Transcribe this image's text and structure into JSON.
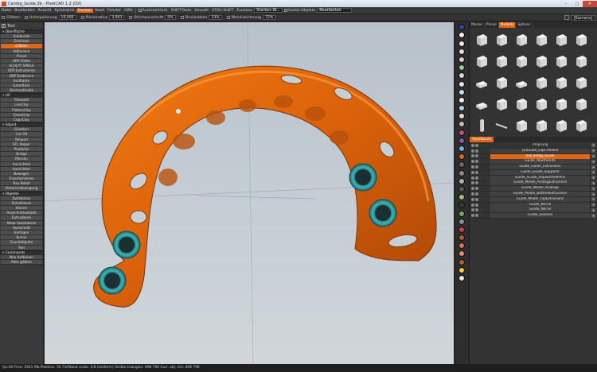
{
  "window": {
    "title": "Cambg_Guide.3b - PixelCAD 1.2 (DX)",
    "min": "–",
    "max": "□",
    "close": "✕"
  },
  "menu": {
    "items": [
      "Datei",
      "Bearbeiten",
      "Ansicht",
      "Symmetrie",
      "Formen",
      "Voxel",
      "Fenster",
      "Hilfe"
    ],
    "active_index": 4,
    "tools": {
      "autosamtrack": "Autosamtrack",
      "shift_taste": "SHIFT-Taste",
      "smooth": "Smooth",
      "strg_shift": "STRG-SHIFT",
      "funktion_label": "Funktion",
      "funktion_value": "Starkes W...",
      "gestor_label": "Gestör-Objekte",
      "bearbeiten": "Bearbeiten"
    }
  },
  "options": {
    "glaetten": "Glätten",
    "unterpolierung_label": "Unterpolierung",
    "unterpolierung_value": "10,000",
    "pinselradius_label": "Pinselradius",
    "pinselradius_value": "3,993",
    "strichausschnitt_label": "Strichausschnitt",
    "strichausschnitt_value": "0%",
    "druckstaerke_label": "Druckstärke",
    "druckstaerke_value": "33%",
    "weichzeichnung_label": "Weichzeichnung",
    "weichzeichnung_value": "72%",
    "camera": "[Kamera]"
  },
  "left_panel": {
    "header": "Tool",
    "groups": [
      {
        "title": "Oberfläche",
        "items": [
          "Subdivide",
          "Zeichnen",
          "Glätten",
          "Abflachen",
          "Pinsel",
          "ORP Füllen",
          "SCULPT SPIELE",
          "ORP Extrudieren",
          "ORP Entfernen",
          "Surfkante",
          "Gaterfläch",
          "Drehmethodik"
        ]
      },
      {
        "title": "UC",
        "items": [
          "TSmooth",
          "LiveClay",
          "FlattenClay",
          "CleanClay",
          "CopyClay"
        ]
      },
      {
        "title": "Adjust",
        "items": [
          "Glaetten",
          "Cut Off",
          "Teleport",
          "STL Repair",
          "Pixelbrüc",
          "Bridge",
          "Messen",
          "Ausrichten",
          "Ausrichten",
          "Bewegen",
          "Transformieren",
          "Bas-Relief",
          "Historienbewegung"
        ]
      },
      {
        "title": "Objekte",
        "items": [
          "Spitzkonus",
          "Extrahieren",
          "Klonen",
          "Ausschnittsobjekt",
          "Extrudieren",
          "Neue Voxelebene",
          "Ausschnitt",
          "Einfügen",
          "Kursiv",
          "Grundobjekte",
          "Text"
        ]
      },
      {
        "title": "Commands",
        "items": [
          "Neu Aufbauen",
          "Alles glätten"
        ]
      }
    ],
    "active_item": "Glätten"
  },
  "palette_colors": [
    "#3a3fa8",
    "#f0f0f0",
    "#e8e8e8",
    "#dcdcdc",
    "#cfcfcf",
    "#8fd08f",
    "#d8d8d8",
    "#e4e4e4",
    "#bfe3f3",
    "#efefef",
    "#a7d7ee",
    "#f4d3d3",
    "#c0c0c0",
    "#c84a8a",
    "#7a5ab0",
    "#7ab0d4",
    "#e0661a",
    "#6a6a6a",
    "#8a8a8a",
    "#b0b0b0",
    "#5a5a5a",
    "#a8c070",
    "#3a3a3a",
    "#6fa860",
    "#8a8a9a",
    "#d04040",
    "#9a6040",
    "#c87848",
    "#e09060",
    "#b06030",
    "#f0d030",
    "#e8e8e8"
  ],
  "right_panel": {
    "tabs": [
      "Maske",
      "Pinsel",
      "Modells",
      "Splines"
    ],
    "active_tab_index": 2,
    "tree_tab": "Voxelbaum",
    "tree": [
      {
        "label": "Ursprung",
        "type": "root"
      },
      {
        "label": "[a]Guide_Gips Modell",
        "type": "normal"
      },
      {
        "label": "[b]Cambg_Guide",
        "type": "selected"
      },
      {
        "label": "Guide_Abutments",
        "type": "normal"
      },
      {
        "label": "Guide_Guide_Extrusions",
        "type": "normal"
      },
      {
        "label": "Guide_Guide_Supports",
        "type": "normal"
      },
      {
        "label": "Guide_Guide_ImplantAndPins",
        "type": "normal"
      },
      {
        "label": "Guide_Model_AnalogExtrusions",
        "type": "normal"
      },
      {
        "label": "Guide_Model_Analogs",
        "type": "normal"
      },
      {
        "label": "Guide_Model_BottomExtrusions",
        "type": "normal"
      },
      {
        "label": "Guide_Model_TopExtrusions",
        "type": "normal"
      },
      {
        "label": "Guide_Nerve",
        "type": "normal"
      },
      {
        "label": "Guide_Nerve",
        "type": "normal"
      },
      {
        "label": "Guide_Sleeves",
        "type": "normal"
      }
    ]
  },
  "status": {
    "text": "fps:60     Free: 2641 Mb,Pixelers: 78  73/Obect scale: 1/8 (Uniform)   Visible triangles: 498 794   Curr. obj. tris: 496 796",
    "right": ""
  }
}
